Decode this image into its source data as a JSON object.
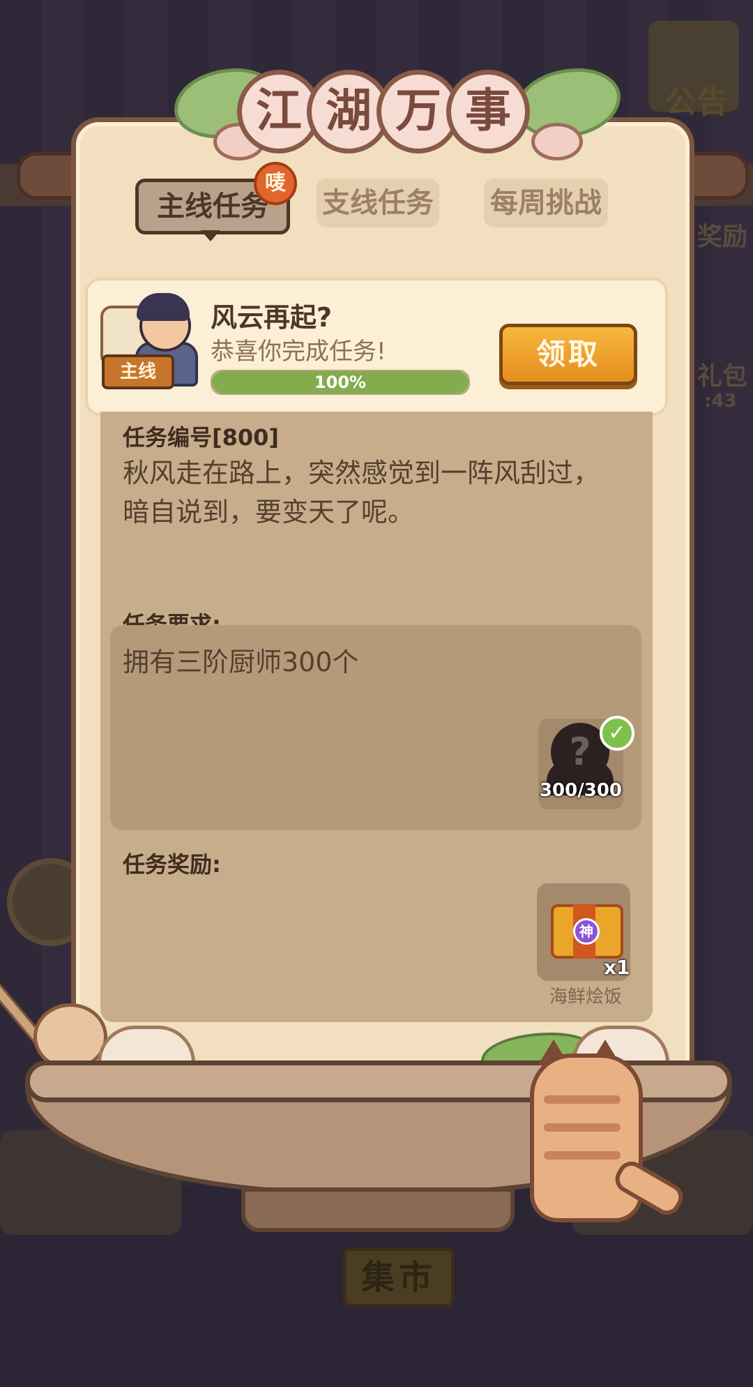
{
  "background": {
    "notice_label": "公告",
    "side_text_right_1": "奖励",
    "side_text_right_2": "礼包",
    "side_timer": ":43",
    "market_label": "集市"
  },
  "dialog": {
    "title_chars": [
      "江",
      "湖",
      "万",
      "事"
    ]
  },
  "tabs": {
    "items": [
      {
        "label": "主线任务",
        "active": true
      },
      {
        "label": "支线任务",
        "active": false
      },
      {
        "label": "每周挑战",
        "active": false
      }
    ],
    "badge": "唛"
  },
  "task": {
    "tag": "主线",
    "name": "风云再起?",
    "status": "恭喜你完成任务!",
    "progress_percent": 100,
    "progress_label": "100%",
    "claim_label": "领取",
    "id_label": "任务编号[800]",
    "description": "秋风走在路上，突然感觉到一阵风刮过，暗自说到，要变天了呢。",
    "requirement_label": "任务要求:",
    "requirement_text": "拥有三阶厨师300个",
    "requirement_icon": "unknown-chef-silhouette-icon",
    "requirement_count": "300/300",
    "reward_label": "任务奖励:",
    "reward_icon": "treasure-chest-icon",
    "reward_gem": "神",
    "reward_qty": "x1",
    "reward_name": "海鲜烩饭"
  },
  "colors": {
    "accent": "#e68e1d",
    "progress": "#82ad4f",
    "panel": "#f2dfbf",
    "detail": "#c8ad8c"
  }
}
